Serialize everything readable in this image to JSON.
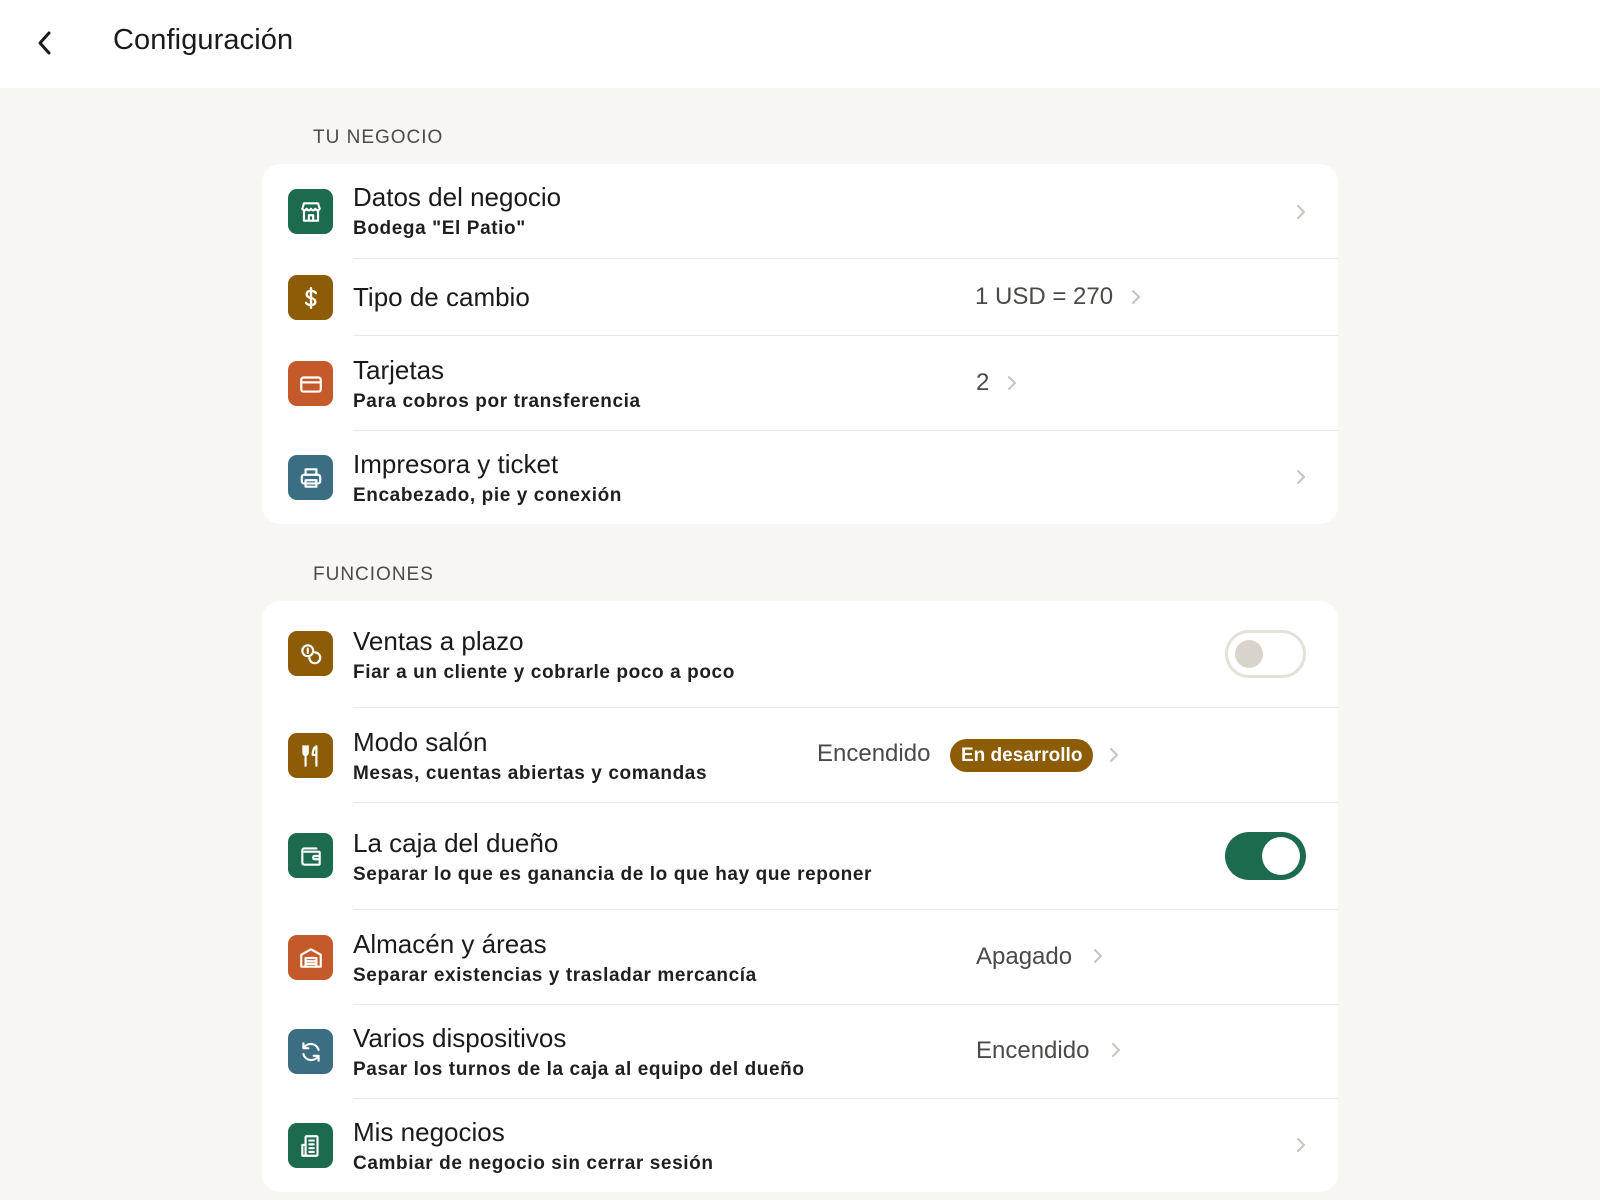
{
  "header": {
    "title": "Configuración"
  },
  "sections": [
    {
      "label": "TU NEGOCIO",
      "items": [
        {
          "title": "Datos del negocio",
          "subtitle": "Bodega \"El Patio\"",
          "icon": "store-icon",
          "color": "#1d6b4f"
        },
        {
          "title": "Tipo de cambio",
          "value": "1 USD = 270",
          "icon": "dollar-icon",
          "color": "#8c5c06"
        },
        {
          "title": "Tarjetas",
          "subtitle": "Para cobros por transferencia",
          "value": "2",
          "icon": "card-icon",
          "color": "#c45a2a"
        },
        {
          "title": "Impresora y ticket",
          "subtitle": "Encabezado, pie y conexión",
          "icon": "printer-icon",
          "color": "#3b6e82"
        }
      ]
    },
    {
      "label": "FUNCIONES",
      "items": [
        {
          "title": "Ventas a plazo",
          "subtitle": "Fiar a un cliente y cobrarle poco a poco",
          "icon": "coins-icon",
          "color": "#8c5c06",
          "toggle": false
        },
        {
          "title": "Modo salón",
          "subtitle": "Mesas, cuentas abiertas y comandas",
          "value": "Encendido",
          "badge": "En desarrollo",
          "icon": "utensils-icon",
          "color": "#8c5c06"
        },
        {
          "title": "La caja del dueño",
          "subtitle": "Separar lo que es ganancia de lo que hay que reponer",
          "icon": "wallet-icon",
          "color": "#1d6b4f",
          "toggle": true
        },
        {
          "title": "Almacén y áreas",
          "subtitle": "Separar existencias y trasladar mercancía",
          "value": "Apagado",
          "icon": "warehouse-icon",
          "color": "#c45a2a"
        },
        {
          "title": "Varios dispositivos",
          "subtitle": "Pasar los turnos de la caja al equipo del dueño",
          "value": "Encendido",
          "icon": "sync-icon",
          "color": "#3b6e82"
        },
        {
          "title": "Mis negocios",
          "subtitle": "Cambiar de negocio sin cerrar sesión",
          "icon": "building-icon",
          "color": "#1d6b4f"
        }
      ]
    }
  ]
}
